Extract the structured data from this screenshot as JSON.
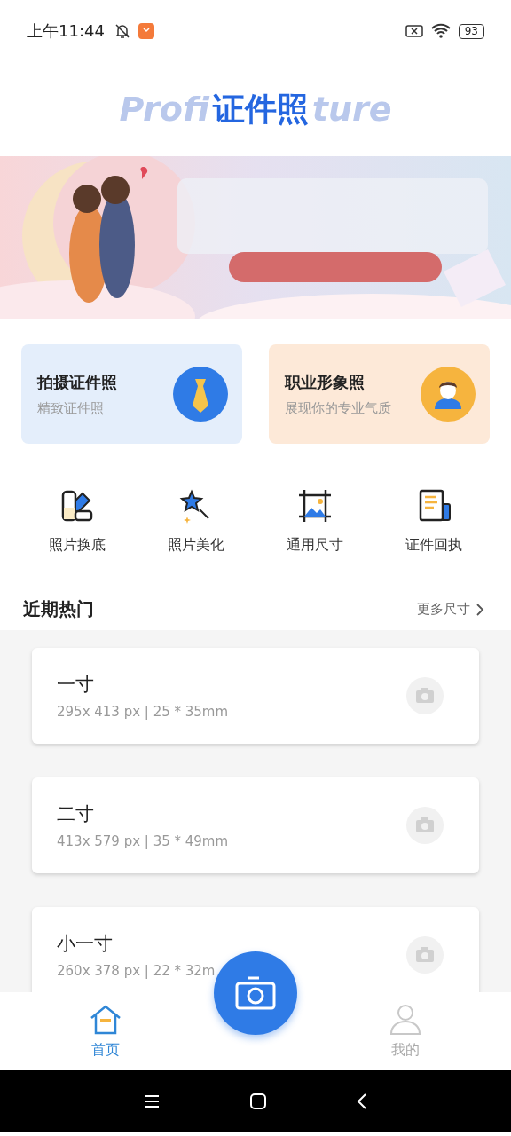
{
  "status_bar": {
    "time": "上午11:44",
    "battery": "93"
  },
  "logo": {
    "title": "证件照",
    "bg_left": "Profi",
    "bg_right": "ture"
  },
  "feature_cards": [
    {
      "title": "拍摄证件照",
      "subtitle": "精致证件照",
      "kind": "tie"
    },
    {
      "title": "职业形象照",
      "subtitle": "展现你的专业气质",
      "kind": "person"
    }
  ],
  "tools": [
    {
      "label": "照片换底",
      "kind": "swatch"
    },
    {
      "label": "照片美化",
      "kind": "wand"
    },
    {
      "label": "通用尺寸",
      "kind": "frame"
    },
    {
      "label": "证件回执",
      "kind": "doc"
    }
  ],
  "section": {
    "title": "近期热门",
    "more": "更多尺寸"
  },
  "sizes": [
    {
      "name": "一寸",
      "spec": "295x 413 px | 25 * 35mm"
    },
    {
      "name": "二寸",
      "spec": "413x 579 px | 35 * 49mm"
    },
    {
      "name": "小一寸",
      "spec": "260x 378 px | 22 * 32m"
    }
  ],
  "tab_bar": [
    {
      "label": "首页",
      "kind": "home",
      "selected": true
    },
    {
      "label": "我的",
      "kind": "me",
      "selected": false
    }
  ]
}
